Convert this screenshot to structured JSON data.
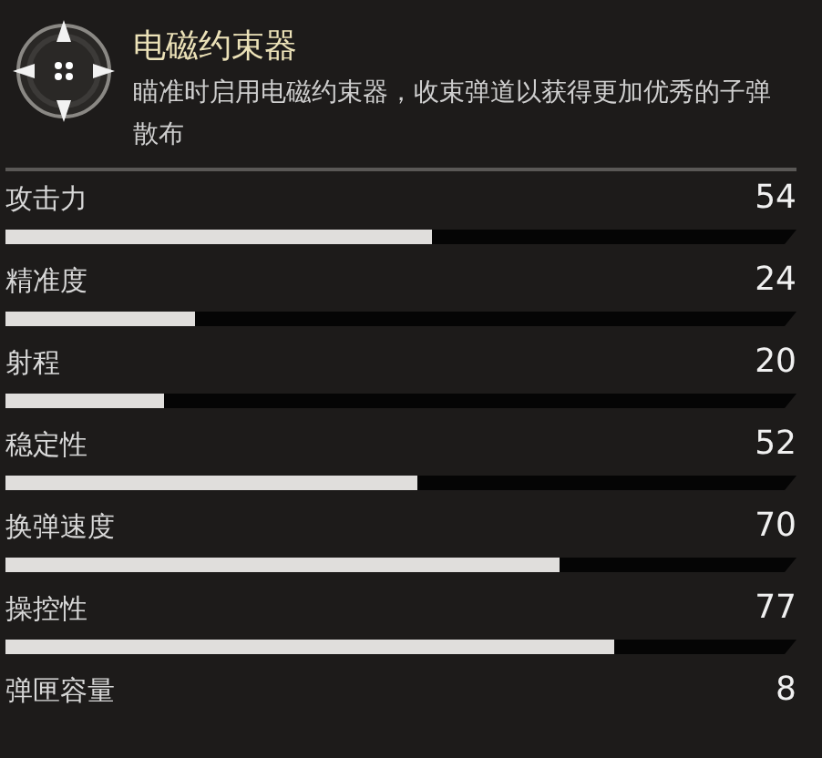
{
  "mod": {
    "title": "电磁约束器",
    "description": "瞄准时启用电磁约束器，收束弹道以获得更加优秀的子弹散布"
  },
  "stats": [
    {
      "kind": "bar",
      "label": "攻击力",
      "value": "54",
      "level": 0.54
    },
    {
      "kind": "bar",
      "label": "精准度",
      "value": "24",
      "level": 0.24
    },
    {
      "kind": "bar",
      "label": "射程",
      "value": "20",
      "level": 0.2
    },
    {
      "kind": "bar",
      "label": "稳定性",
      "value": "52",
      "level": 0.52
    },
    {
      "kind": "bar",
      "label": "换弹速度",
      "value": "70",
      "level": 0.7
    },
    {
      "kind": "bar",
      "label": "操控性",
      "value": "77",
      "level": 0.77
    },
    {
      "kind": "plain",
      "label": "弹匣容量",
      "value": "8"
    }
  ]
}
